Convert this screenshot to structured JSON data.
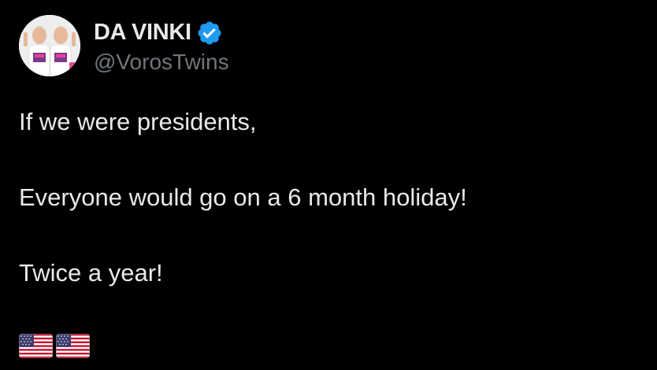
{
  "tweet": {
    "display_name": "DA VINKI",
    "handle": "@VorosTwins",
    "verified": true,
    "lines": [
      "If we were presidents,",
      "Everyone would go on a 6 month holiday!",
      "Twice a year!"
    ],
    "emojis": [
      "us-flag-icon",
      "us-flag-icon"
    ]
  },
  "colors": {
    "background": "#000000",
    "text_primary": "#e7e9ea",
    "text_secondary": "#71767b",
    "verified_badge": "#1d9bf0"
  }
}
